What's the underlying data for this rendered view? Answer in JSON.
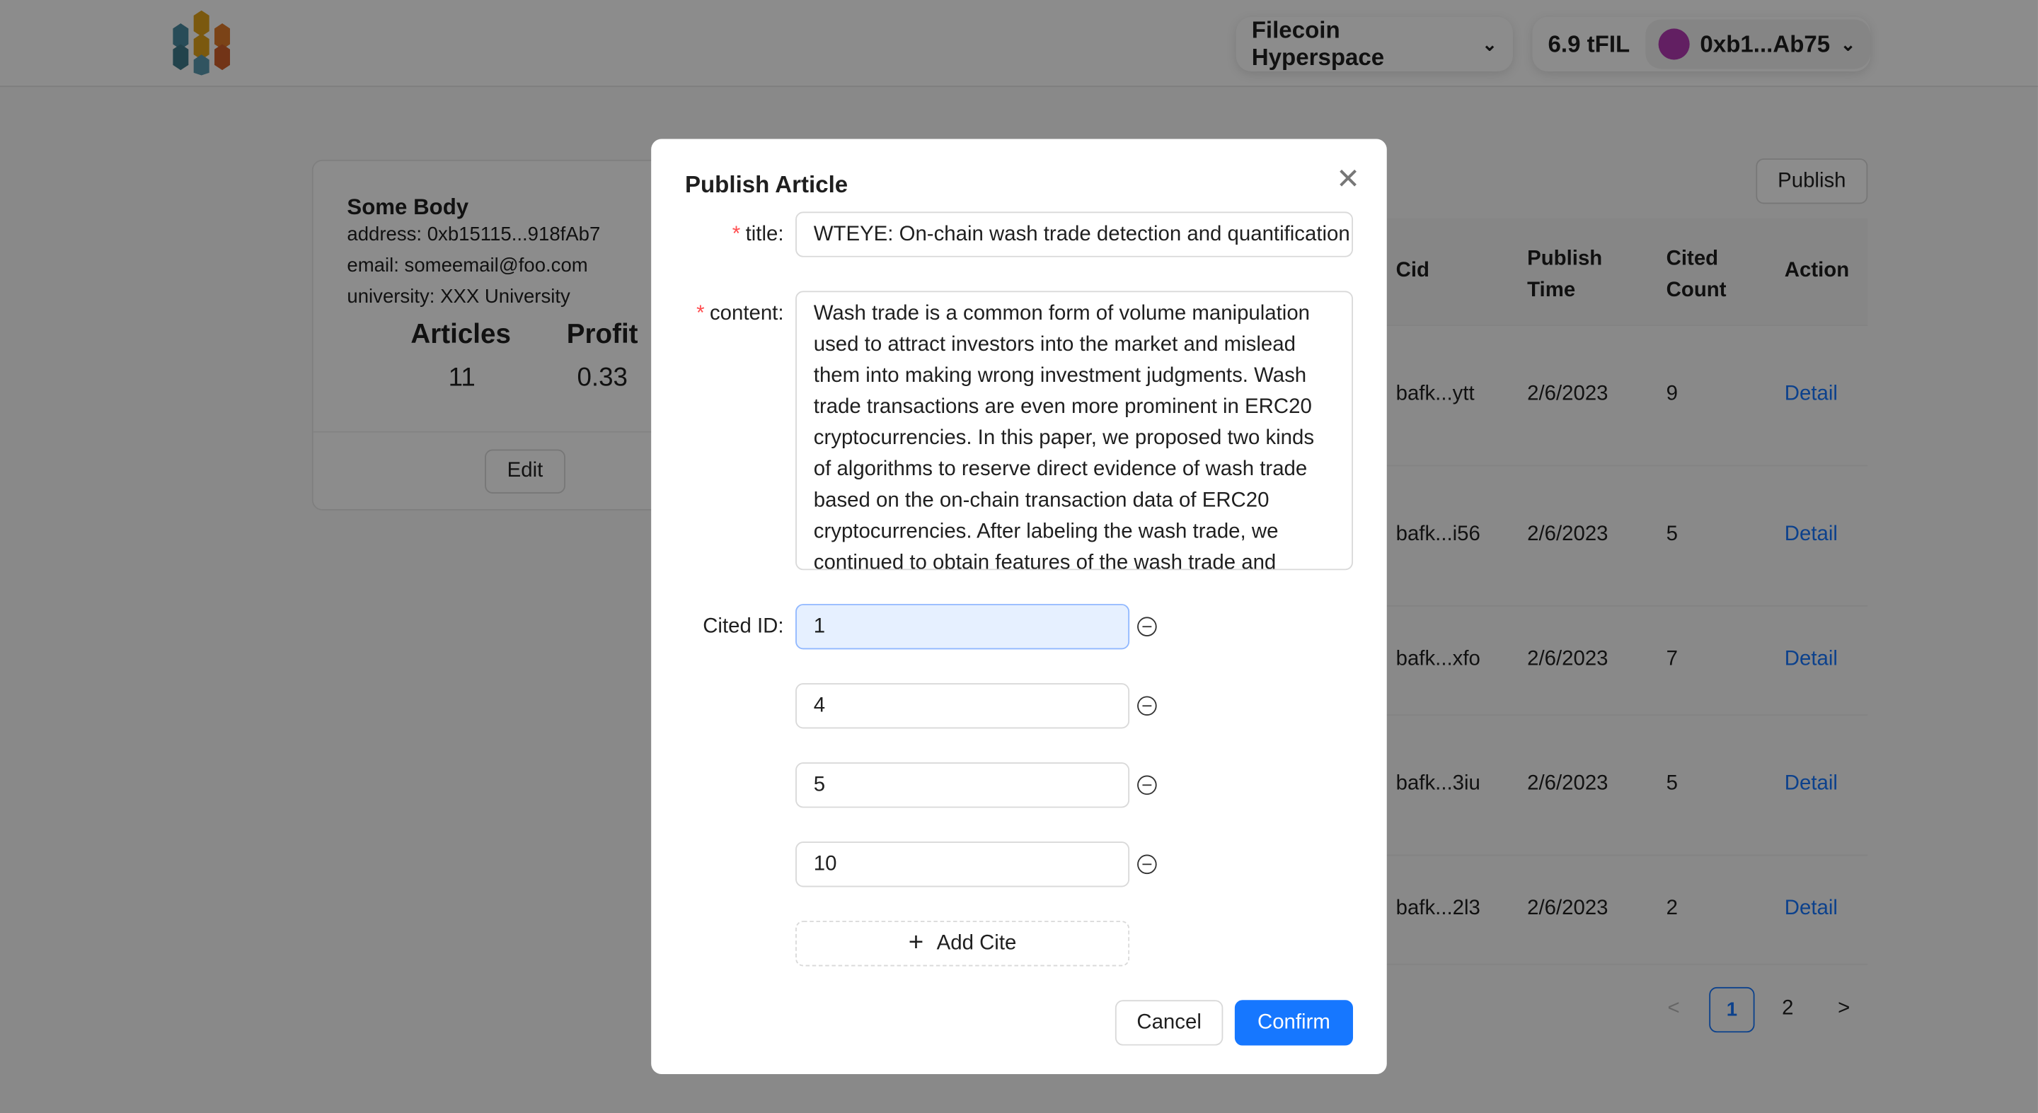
{
  "header": {
    "network": "Filecoin Hyperspace",
    "balance": "6.9 tFIL",
    "account": "0xb1...Ab75"
  },
  "profile": {
    "name": "Some Body",
    "address": "address: 0xb15115...918fAb7",
    "email": "email: someemail@foo.com",
    "university": "university: XXX University",
    "articles_label": "Articles",
    "articles": "11",
    "profit_label": "Profit",
    "profit": "0.33",
    "edit": "Edit"
  },
  "publish_button": "Publish",
  "table": {
    "headers": [
      "Cid",
      "Publish Time",
      "Cited Count",
      "Action"
    ],
    "rows": [
      {
        "cid": "bafk...ytt",
        "time": "2/6/2023",
        "count": "9",
        "action": "Detail"
      },
      {
        "cid": "bafk...i56",
        "time": "2/6/2023",
        "count": "5",
        "action": "Detail"
      },
      {
        "cid": "bafk...xfo",
        "time": "2/6/2023",
        "count": "7",
        "action": "Detail"
      },
      {
        "cid": "bafk...3iu",
        "time": "2/6/2023",
        "count": "5",
        "action": "Detail"
      },
      {
        "cid": "bafk...2l3",
        "time": "2/6/2023",
        "count": "2",
        "action": "Detail"
      }
    ]
  },
  "pagination": {
    "prev": "<",
    "pages": [
      "1",
      "2"
    ],
    "current": "1",
    "next": ">"
  },
  "modal": {
    "title": "Publish Article",
    "title_label": "title",
    "title_value": "WTEYE: On-chain wash trade detection and quantification",
    "content_label": "content",
    "content_value": "Wash trade is a common form of volume manipulation used to attract investors into the market and mislead them into making wrong investment judgments. Wash trade transactions are even more prominent in ERC20 cryptocurrencies. In this paper, we proposed two kinds of algorithms to reserve direct evidence of wash trade based on the on-chain transaction data of ERC20 cryptocurrencies. After labeling the wash trade, we continued to obtain features of the wash trade and",
    "cited_label": "Cited ID",
    "cited_ids": [
      "1",
      "4",
      "5",
      "10"
    ],
    "add_cite": "Add Cite",
    "cancel": "Cancel",
    "confirm": "Confirm"
  },
  "colors": {
    "primary": "#1677ff",
    "link": "#1677ff",
    "focus_bg": "#e6f0ff"
  }
}
